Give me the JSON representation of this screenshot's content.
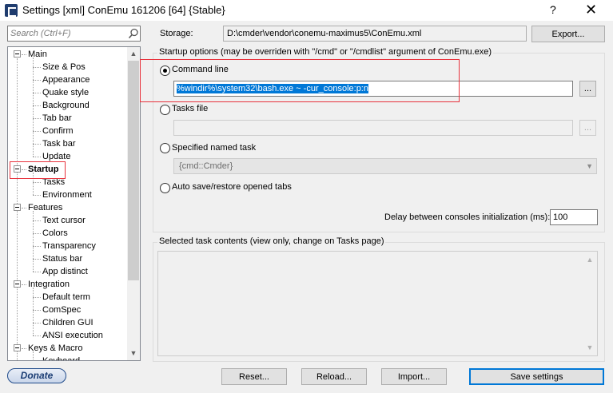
{
  "window": {
    "title": "Settings [xml] ConEmu 161206 [64] {Stable}",
    "help_glyph": "?",
    "close_glyph": "✕"
  },
  "search": {
    "placeholder": "Search (Ctrl+F)"
  },
  "tree": {
    "items": [
      {
        "label": "Main",
        "level": 0,
        "expander": true
      },
      {
        "label": "Size & Pos",
        "level": 1
      },
      {
        "label": "Appearance",
        "level": 1
      },
      {
        "label": "Quake style",
        "level": 1
      },
      {
        "label": "Background",
        "level": 1
      },
      {
        "label": "Tab bar",
        "level": 1
      },
      {
        "label": "Confirm",
        "level": 1
      },
      {
        "label": "Task bar",
        "level": 1
      },
      {
        "label": "Update",
        "level": 1
      },
      {
        "label": "Startup",
        "level": 0,
        "expander": true,
        "selected": true
      },
      {
        "label": "Tasks",
        "level": 1
      },
      {
        "label": "Environment",
        "level": 1
      },
      {
        "label": "Features",
        "level": 0,
        "expander": true
      },
      {
        "label": "Text cursor",
        "level": 1
      },
      {
        "label": "Colors",
        "level": 1
      },
      {
        "label": "Transparency",
        "level": 1
      },
      {
        "label": "Status bar",
        "level": 1
      },
      {
        "label": "App distinct",
        "level": 1
      },
      {
        "label": "Integration",
        "level": 0,
        "expander": true
      },
      {
        "label": "Default term",
        "level": 1
      },
      {
        "label": "ComSpec",
        "level": 1
      },
      {
        "label": "Children GUI",
        "level": 1
      },
      {
        "label": "ANSI execution",
        "level": 1
      },
      {
        "label": "Keys & Macro",
        "level": 0,
        "expander": true
      },
      {
        "label": "Keyboard",
        "level": 1
      }
    ]
  },
  "storage": {
    "label": "Storage:",
    "path": "D:\\cmder\\vendor\\conemu-maximus5\\ConEmu.xml",
    "export_label": "Export..."
  },
  "startup_options": {
    "group_title": "Startup options (may be overriden with \"/cmd\" or \"/cmdlist\" argument of ConEmu.exe)",
    "command_line_label": "Command line",
    "command_line_value": "%windir%\\system32\\bash.exe ~ -cur_console:p:n",
    "tasks_file_label": "Tasks file",
    "tasks_file_value": "",
    "named_task_label": "Specified named task",
    "named_task_value": "{cmd::Cmder}",
    "auto_save_label": "Auto save/restore opened tabs",
    "browse_label": "...",
    "selected_option": "command_line"
  },
  "delay": {
    "label": "Delay between consoles initialization (ms):",
    "value": "100"
  },
  "task_contents": {
    "group_title": "Selected task contents (view only, change on Tasks page)"
  },
  "footer": {
    "donate_label": "Donate",
    "reset_label": "Reset...",
    "reload_label": "Reload...",
    "import_label": "Import...",
    "save_label": "Save settings"
  },
  "colors": {
    "highlight": "#e8323c",
    "selection": "#0078d7",
    "accent_border": "#0078d7"
  }
}
